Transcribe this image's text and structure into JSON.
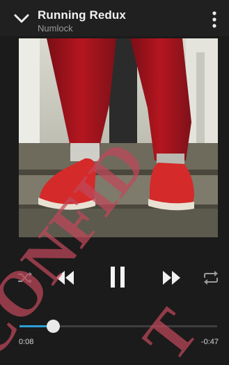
{
  "header": {
    "title": "Running Redux",
    "artist": "Numlock",
    "collapse_icon": "chevron-down-icon",
    "menu_icon": "more-vertical-icon"
  },
  "album_art": {
    "description_icon": "album-art"
  },
  "controls": {
    "shuffle_icon": "shuffle-icon",
    "previous_icon": "rewind-icon",
    "play_pause_icon": "pause-icon",
    "next_icon": "fast-forward-icon",
    "repeat_icon": "repeat-icon"
  },
  "progress": {
    "elapsed": "0:08",
    "remaining": "-0:47",
    "fraction": 0.17
  },
  "colors": {
    "accent": "#2e9fd6",
    "background": "#1b1b1b",
    "watermark": "#c0485a"
  }
}
